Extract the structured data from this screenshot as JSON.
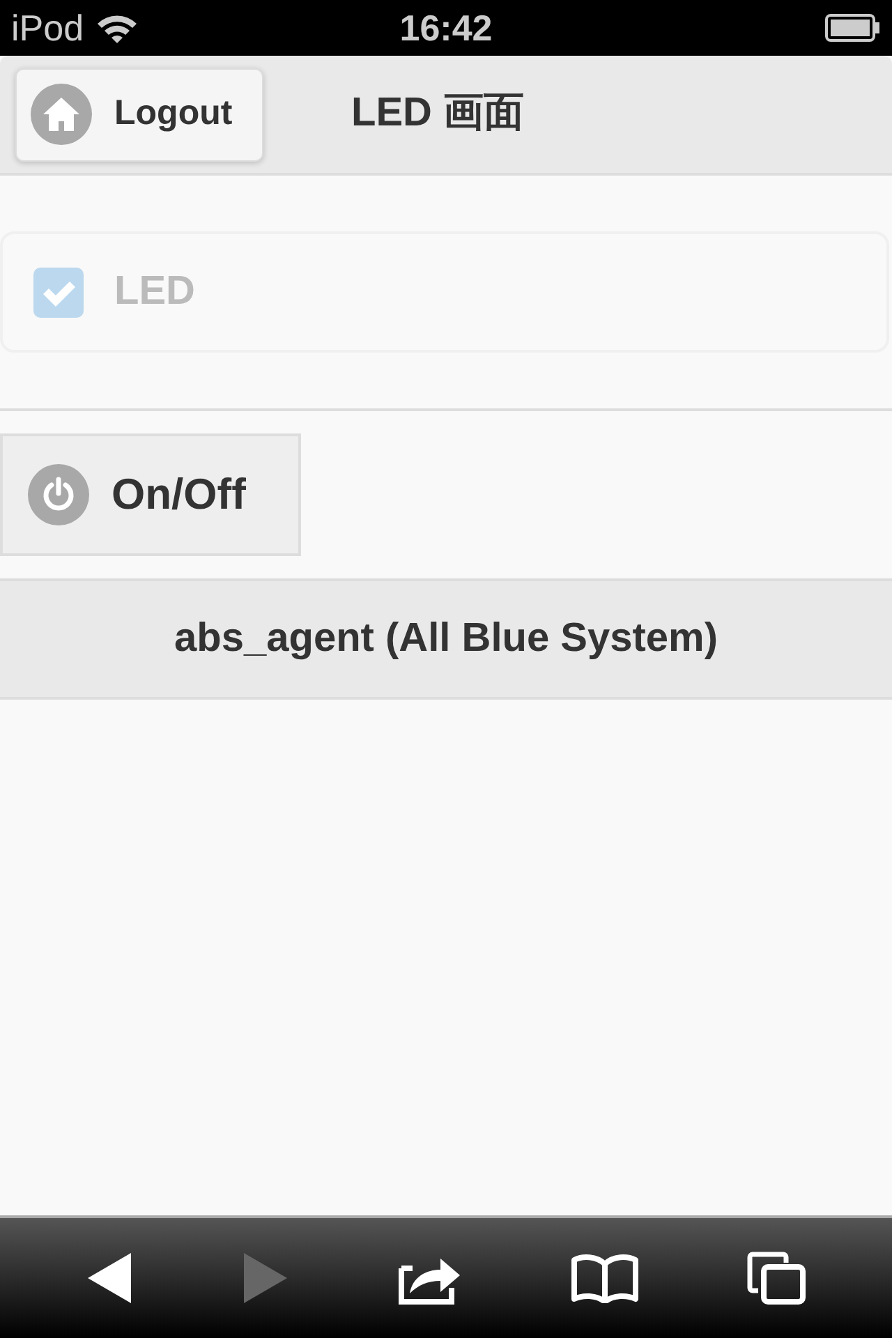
{
  "status_bar": {
    "carrier": "iPod",
    "time": "16:42"
  },
  "header": {
    "button": "Logout",
    "title": "LED 画面"
  },
  "led_checkbox": {
    "label": "LED",
    "checked": true,
    "disabled": true
  },
  "power_button": {
    "label": "On/Off"
  },
  "footer": {
    "text": "abs_agent (All Blue System)"
  },
  "toolbar": [
    {
      "kind": "back",
      "disabled": false
    },
    {
      "kind": "forward",
      "disabled": true
    },
    {
      "kind": "share",
      "disabled": false
    },
    {
      "kind": "bookmarks",
      "disabled": false
    },
    {
      "kind": "tabs",
      "disabled": false
    }
  ]
}
